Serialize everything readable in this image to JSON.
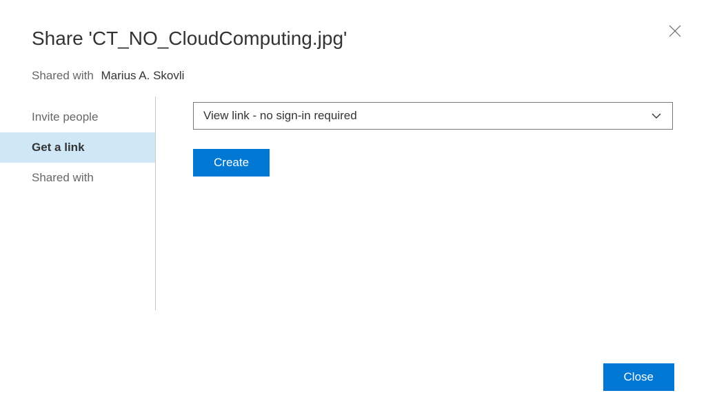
{
  "dialog": {
    "title": "Share 'CT_NO_CloudComputing.jpg'",
    "sharedWithLabel": "Shared with",
    "sharedWithName": "Marius A. Skovli"
  },
  "sidebar": {
    "items": [
      {
        "label": "Invite people"
      },
      {
        "label": "Get a link"
      },
      {
        "label": "Shared with"
      }
    ]
  },
  "main": {
    "linkTypeSelected": "View link - no sign-in required",
    "createLabel": "Create"
  },
  "footer": {
    "closeLabel": "Close"
  },
  "colors": {
    "accent": "#0078D4",
    "selectedBg": "#D0E7F8"
  }
}
